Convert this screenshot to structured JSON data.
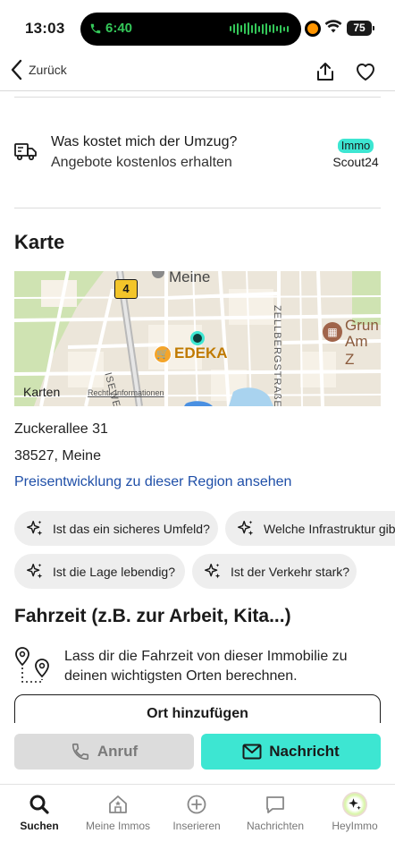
{
  "status_bar": {
    "time": "13:03",
    "call_duration": "6:40",
    "battery": "75"
  },
  "nav": {
    "back_label": "Zurück",
    "icons": [
      "chevron-left-icon",
      "share-icon",
      "heart-icon"
    ]
  },
  "moving": {
    "title": "Was kostet mich der Umzug?",
    "subtitle": "Angebote kostenlos erhalten",
    "logo_top": "Immo",
    "logo_bottom": "Scout24"
  },
  "map_section": {
    "heading": "Karte",
    "labels": {
      "town": "Meine",
      "road_badge": "4",
      "store": "EDEKA",
      "street_vertical": "ZELLBERGSTRAßE",
      "street_diag": "ISEWEG",
      "poi_line1": "Grun",
      "poi_line2": "Am Z",
      "attribution_brand": "Karten",
      "attribution_legal": "Rechtl. Informationen"
    }
  },
  "address": {
    "street": "Zuckerallee 31",
    "city": "38527, Meine",
    "price_link": "Preisentwicklung zu dieser Region ansehen"
  },
  "ai_questions": [
    "Ist das ein sicheres Umfeld?",
    "Welche Infrastruktur gibt es?",
    "Ist die Lage lebendig?",
    "Ist der Verkehr stark?"
  ],
  "commute": {
    "heading": "Fahrzeit (z.B. zur Arbeit, Kita...)",
    "text": "Lass dir die Fahrzeit von dieser Immobilie zu deinen wichtigsten Orten berechnen.",
    "add_button": "Ort hinzufügen"
  },
  "actions": {
    "call": "Anruf",
    "message": "Nachricht"
  },
  "tabbar": [
    {
      "label": "Suchen",
      "icon": "search-icon",
      "active": true
    },
    {
      "label": "Meine Immos",
      "icon": "house-icon",
      "active": false
    },
    {
      "label": "Inserieren",
      "icon": "plus-circle-icon",
      "active": false
    },
    {
      "label": "Nachrichten",
      "icon": "chat-icon",
      "active": false
    },
    {
      "label": "HeyImmo",
      "icon": "sparkle-icon",
      "active": false
    }
  ],
  "colors": {
    "accent": "#3de6d2",
    "link": "#1f4fa8",
    "chip_bg": "#eeeeee",
    "disabled_button": "#dcdcdc"
  }
}
